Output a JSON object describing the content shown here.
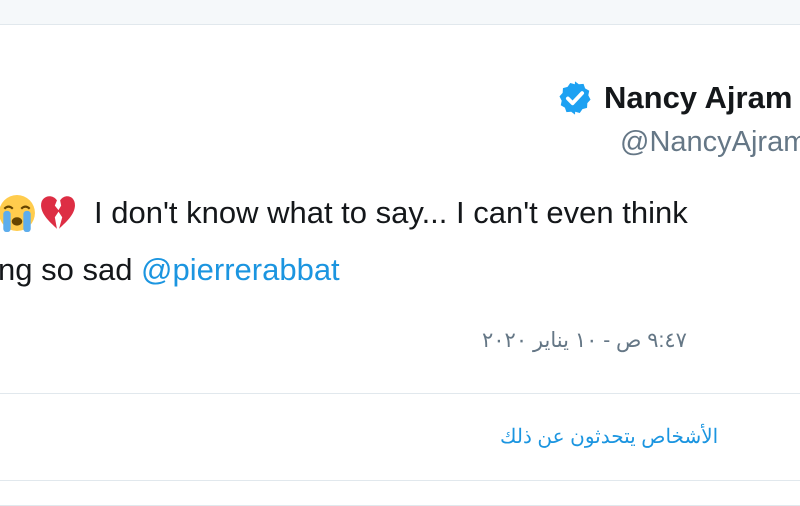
{
  "tweet": {
    "author": {
      "display_name": "Nancy Ajram",
      "handle": "@NancyAjram",
      "verified_icon": "verified-badge-icon"
    },
    "text": {
      "line1_emojis": [
        "crying-face-emoji-icon",
        "broken-heart-emoji-icon"
      ],
      "line1": "I don't know what to say... I can't even think",
      "line2_prefix": "ng so sad ",
      "mention": "@pierrerabbat"
    },
    "timestamp": "٩:٤٧ ص - ١٠ يناير ٢٠٢٠",
    "footer_link": "الأشخاص يتحدثون عن ذلك"
  },
  "colors": {
    "link": "#1b95e0",
    "verified": "#1da1f2",
    "text": "#14171a",
    "muted": "#657786"
  }
}
